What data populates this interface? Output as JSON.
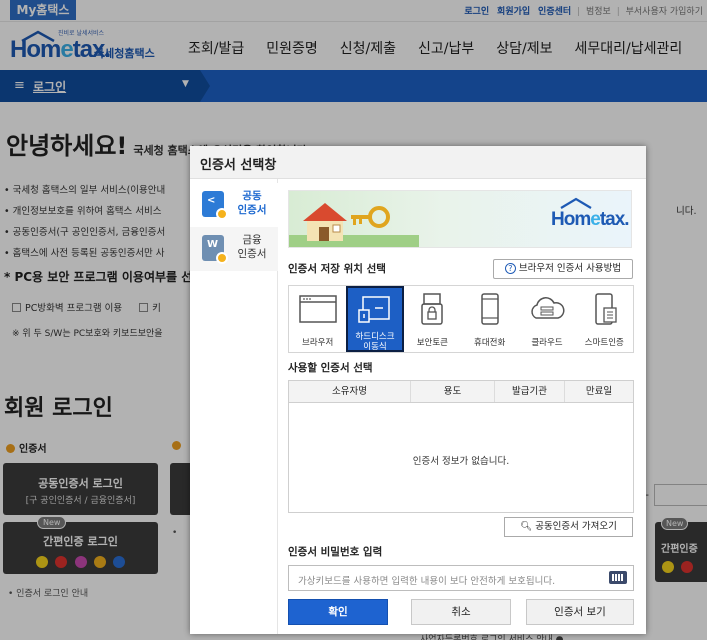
{
  "topbar": {
    "my_tab": "My홈택스",
    "links": [
      "로그인",
      "회원가입",
      "인증센터"
    ],
    "muted": [
      "범정보",
      "부서사용자 가입하기"
    ]
  },
  "header": {
    "logo_tag": "진비로 날세서비스",
    "logo_word_a": "Hom",
    "logo_word_e": "e",
    "logo_word_b": "tax.",
    "logo_ko": "국세청홈택스",
    "nav": [
      "조회/발급",
      "민원증명",
      "신청/제출",
      "신고/납부",
      "상담/제보",
      "세무대리/납세관리"
    ]
  },
  "subbar": {
    "login_label": "로그인"
  },
  "background": {
    "greeting": "안녕하세요!",
    "greeting_sub": "국세청 홈택스에 오신것을 환영합니다",
    "notes": [
      "• 국세청 홈택스의 일부 서비스(이용안내",
      "• 개인정보보호를 위하여 홈택스 서비스",
      "• 공동인증서(구 공인인증서, 금융인증서",
      "• 홈택스에 사전 등록된 공동인증서만 사"
    ],
    "notes_right": "니다.",
    "pc_title": "* PC용 보안 프로그램 이용여부를 선",
    "check1": "PC방화벽 프로그램 이용",
    "check2": "키",
    "warn": "※ 위 두 S/W는 PC보호와 키보드보안을",
    "member_title": "회원 로그인",
    "cert_label": "인증서",
    "cert_btn_line1": "공동인증서 로그인",
    "cert_btn_line2": "[구 공인인증서 / 금융인증서]",
    "new_badge": "New",
    "simple_login": "간편인증 로그인",
    "guide": "• 인증서 로그인 안내",
    "right_simple": "간편인증",
    "right_dash": "-",
    "stub_dot": "•",
    "bottom_text": "사업자등록번호 로그인 서비스 안내 ●"
  },
  "modal": {
    "title": "인증서 선택창",
    "side": [
      {
        "label": "공동\n인증서",
        "icon": "joint-cert-icon"
      },
      {
        "label": "금융\n인증서",
        "icon": "finance-cert-icon"
      }
    ],
    "banner_logo_a": "Hom",
    "banner_logo_e": "e",
    "banner_logo_b": "tax.",
    "storage_label": "인증서 저장 위치 선택",
    "help_button": "브라우저 인증서 사용방법",
    "storage_options": [
      {
        "label": "브라우저",
        "icon": "browser-icon"
      },
      {
        "label": "하드디스크\n이동식",
        "icon": "harddisk-icon",
        "selected": true
      },
      {
        "label": "보안토큰",
        "icon": "security-token-icon"
      },
      {
        "label": "휴대전화",
        "icon": "mobile-phone-icon"
      },
      {
        "label": "클라우드",
        "icon": "cloud-icon"
      },
      {
        "label": "스마트인증",
        "icon": "smart-cert-icon"
      }
    ],
    "cert_select_label": "사용할 인증서 선택",
    "columns": [
      "소유자명",
      "용도",
      "발급기관",
      "만료일"
    ],
    "empty_message": "인증서 정보가 없습니다.",
    "import_button": "공동인증서 가져오기",
    "password_label": "인증서 비밀번호 입력",
    "password_placeholder": "가상키보드를 사용하면 입력한 내용이 보다 안전하게 보호됩니다.",
    "ok": "확인",
    "cancel": "취소",
    "view": "인증서 보기"
  },
  "colors": {
    "brand_blue": "#1e62c7",
    "selected": "#1d5fc5",
    "ok_button": "#1e63d0"
  }
}
